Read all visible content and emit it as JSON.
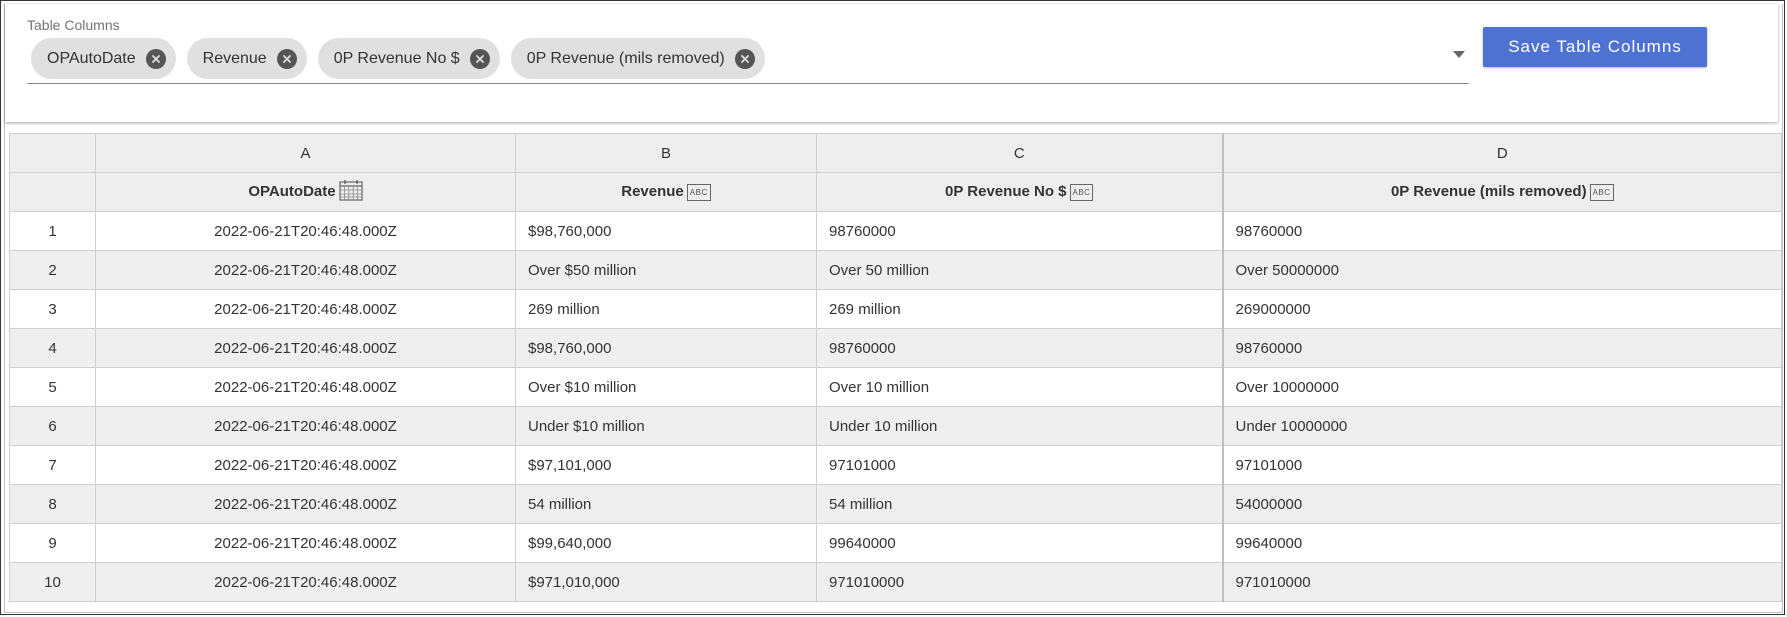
{
  "panel": {
    "field_label": "Table Columns",
    "chips": [
      {
        "label": "OPAutoDate"
      },
      {
        "label": "Revenue"
      },
      {
        "label": "0P Revenue No $"
      },
      {
        "label": "0P Revenue (mils removed)"
      }
    ],
    "save_label": "Save Table Columns",
    "accent_color": "#4e72d1"
  },
  "table": {
    "column_letters": [
      "A",
      "B",
      "C",
      "D"
    ],
    "headers": [
      {
        "label": "OPAutoDate",
        "type_icon": "calendar-icon"
      },
      {
        "label": "Revenue",
        "type_icon": "abc-icon"
      },
      {
        "label": "0P Revenue No $",
        "type_icon": "abc-icon"
      },
      {
        "label": "0P Revenue (mils removed)",
        "type_icon": "abc-icon"
      }
    ],
    "type_icon_text": "ABC",
    "rows": [
      {
        "n": "1",
        "a": "2022-06-21T20:46:48.000Z",
        "b": "$98,760,000",
        "c": "98760000",
        "d": "98760000"
      },
      {
        "n": "2",
        "a": "2022-06-21T20:46:48.000Z",
        "b": "Over $50 million",
        "c": "Over 50 million",
        "d": "Over 50000000"
      },
      {
        "n": "3",
        "a": "2022-06-21T20:46:48.000Z",
        "b": "269 million",
        "c": "269 million",
        "d": "269000000"
      },
      {
        "n": "4",
        "a": "2022-06-21T20:46:48.000Z",
        "b": "$98,760,000",
        "c": "98760000",
        "d": "98760000"
      },
      {
        "n": "5",
        "a": "2022-06-21T20:46:48.000Z",
        "b": "Over $10 million",
        "c": "Over 10 million",
        "d": "Over 10000000"
      },
      {
        "n": "6",
        "a": "2022-06-21T20:46:48.000Z",
        "b": "Under $10 million",
        "c": "Under 10 million",
        "d": "Under 10000000"
      },
      {
        "n": "7",
        "a": "2022-06-21T20:46:48.000Z",
        "b": "$97,101,000",
        "c": "97101000",
        "d": "97101000"
      },
      {
        "n": "8",
        "a": "2022-06-21T20:46:48.000Z",
        "b": "54 million",
        "c": "54 million",
        "d": "54000000"
      },
      {
        "n": "9",
        "a": "2022-06-21T20:46:48.000Z",
        "b": "$99,640,000",
        "c": "99640000",
        "d": "99640000"
      },
      {
        "n": "10",
        "a": "2022-06-21T20:46:48.000Z",
        "b": "$971,010,000",
        "c": "971010000",
        "d": "971010000"
      }
    ]
  }
}
